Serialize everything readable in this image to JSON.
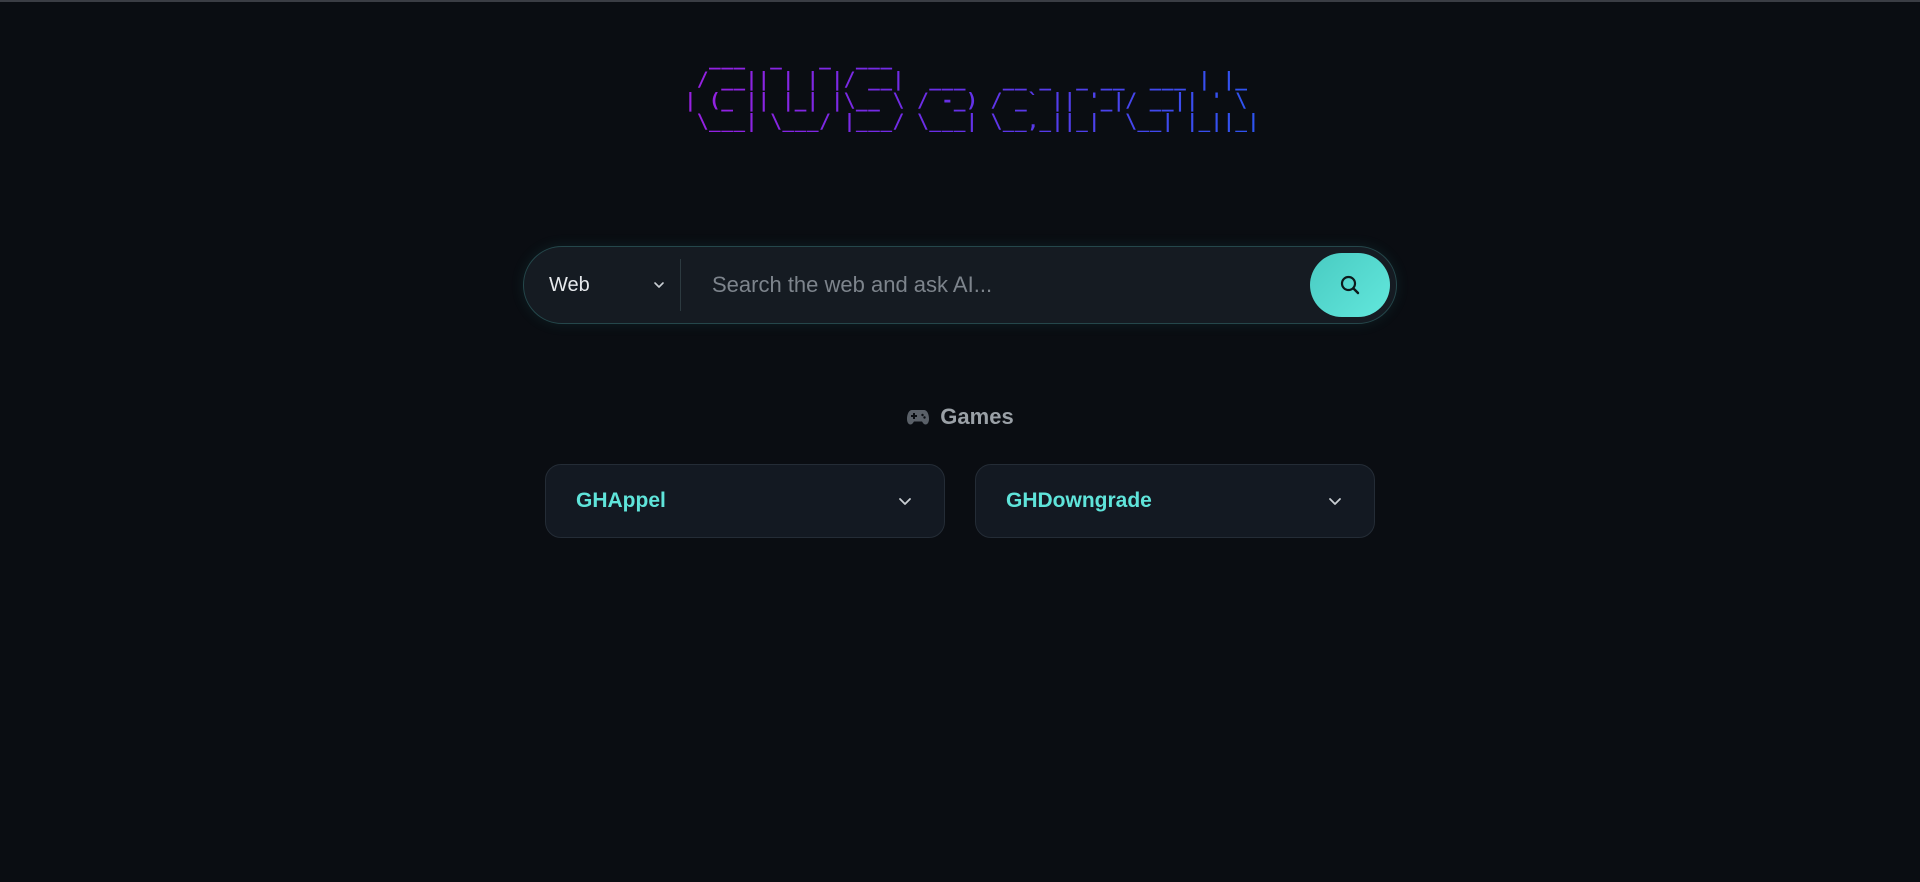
{
  "logo": {
    "ascii": "   ___  _   _  ___\n  / __|| | | |/ __|  ___   __ _  _ __  ___ | |_\n | (_ || |_| |\\__ \\ / -_) / _` || '_|/ __|| ' \\\n  \\___| \\___/ |___/ \\___| \\__,_||_|  \\__| |_||_|",
    "text": "GHSearch",
    "colors": [
      "#9a1fe0",
      "#2d55f0"
    ]
  },
  "search": {
    "mode_selected": "Web",
    "placeholder": "Search the web and ask AI...",
    "value": "",
    "submit_icon": "search-icon"
  },
  "games_section": {
    "icon": "gamepad-icon",
    "title": "Games",
    "items": [
      {
        "label": "GHAppel",
        "icon": "chevron-down-icon"
      },
      {
        "label": "GHDowngrade",
        "icon": "chevron-down-icon"
      }
    ]
  },
  "colors": {
    "background": "#0a0d12",
    "accent": "#5fe4da",
    "button_gradient": [
      "#49cbc2",
      "#62e7dc"
    ]
  }
}
